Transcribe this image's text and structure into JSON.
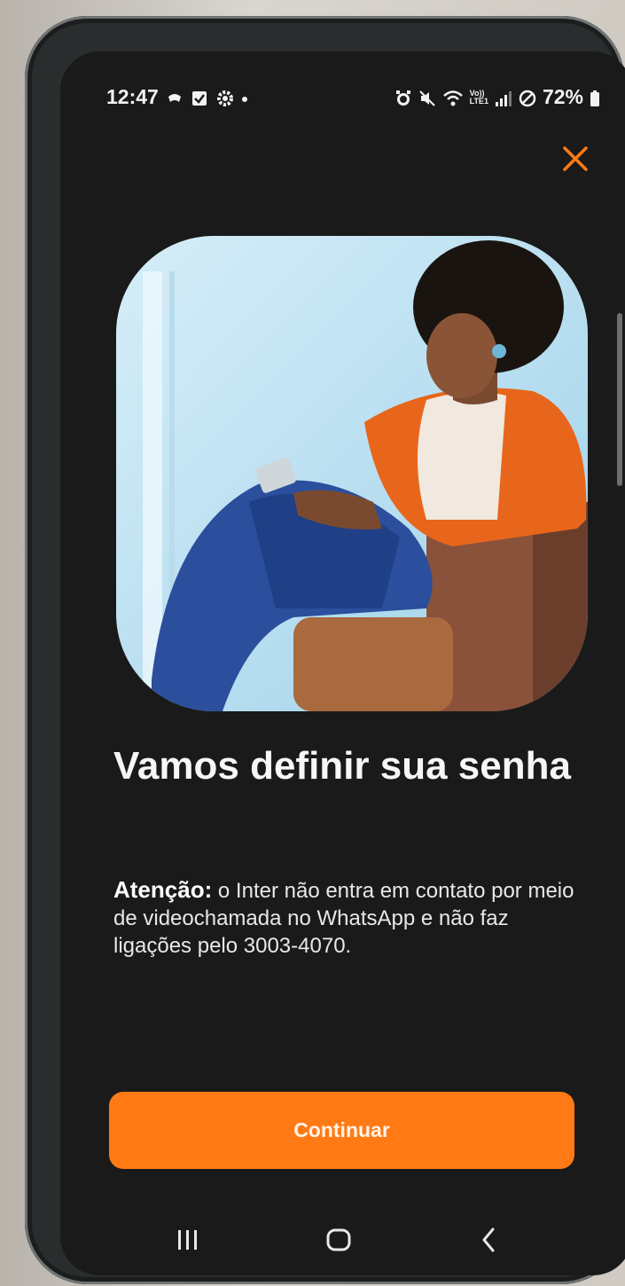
{
  "status_bar": {
    "time": "12:47",
    "battery_percent": "72%",
    "left_icons": [
      "notification-icon",
      "check-square-icon",
      "settings-gear-icon",
      "dot-icon"
    ],
    "right_icons": [
      "alarm-icon",
      "mute-icon",
      "wifi-icon",
      "volte-lte-icon",
      "signal-icon",
      "do-not-disturb-icon",
      "battery-icon"
    ],
    "volte_label": "Vo))\nLTE1"
  },
  "header": {
    "close_icon": "close-icon",
    "accent_color": "#ff7a14"
  },
  "hero": {
    "image": "woman-sitting-with-phone-photo"
  },
  "main": {
    "title": "Vamos definir sua senha",
    "notice_prefix": "Atenção:",
    "notice_text": " o Inter não entra em contato por meio de videochamada no WhatsApp e não faz ligações pelo 3003-4070."
  },
  "actions": {
    "continue_label": "Continuar"
  },
  "nav_bar": {
    "recents_icon": "recents-icon",
    "home_icon": "home-icon",
    "back_icon": "back-icon"
  }
}
